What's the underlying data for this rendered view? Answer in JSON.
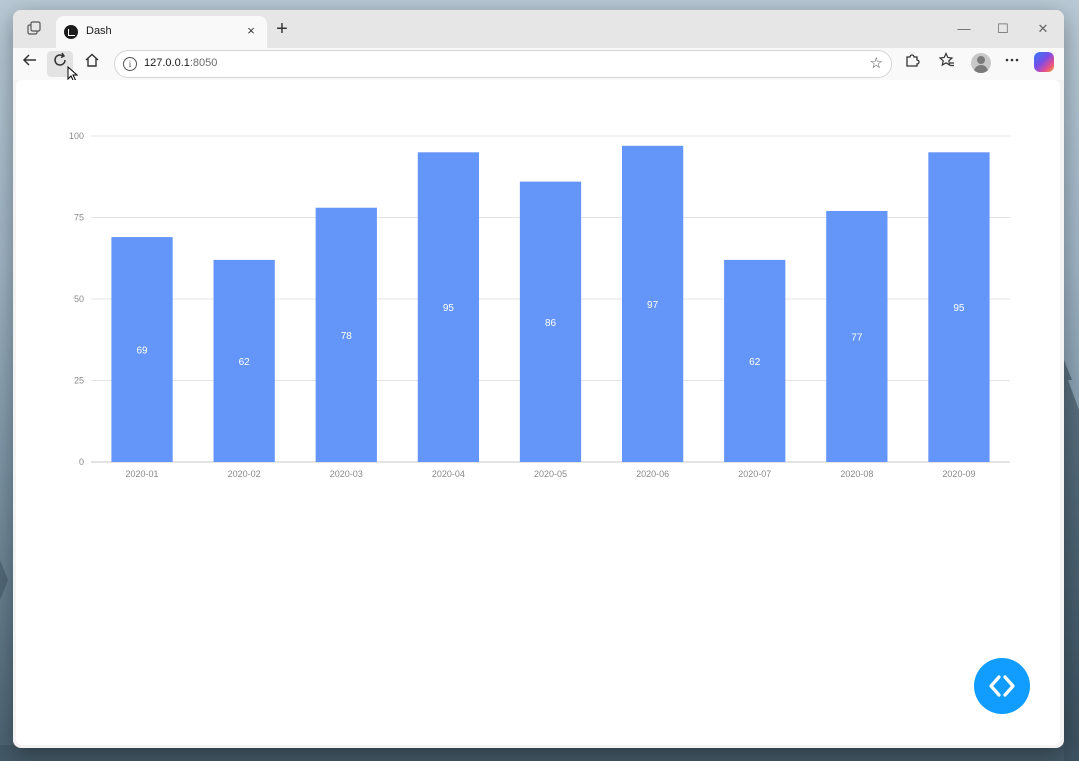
{
  "browser": {
    "tab_title": "Dash",
    "tab_close": "×",
    "new_tab": "+",
    "address_host": "127.0.0.1",
    "address_port": ":8050",
    "window_controls": {
      "minimize": "—",
      "maximize": "☐",
      "close": "✕"
    },
    "icons": {
      "workspaces": "workspaces-icon",
      "back": "back-arrow-icon",
      "refresh": "refresh-icon",
      "home": "home-icon",
      "site_info": "info-icon",
      "favorite": "star-icon",
      "extensions": "extensions-icon",
      "favorites": "favorites-icon",
      "profile": "profile-avatar-icon",
      "more": "more-dots-icon",
      "copilot": "copilot-icon"
    }
  },
  "colors": {
    "bar": "#6495f9",
    "bar_label": "#ffffff",
    "grid": "#e4e4e4",
    "tick_text": "#8a8a8a",
    "fab": "#119dff"
  },
  "fab": {
    "icon": "code-brackets-icon"
  },
  "chart_data": {
    "type": "bar",
    "categories": [
      "2020-01",
      "2020-02",
      "2020-03",
      "2020-04",
      "2020-05",
      "2020-06",
      "2020-07",
      "2020-08",
      "2020-09"
    ],
    "values": [
      69,
      62,
      78,
      95,
      86,
      97,
      62,
      77,
      95
    ],
    "ylim": [
      0,
      100
    ],
    "yticks": [
      0,
      25,
      50,
      75,
      100
    ],
    "grid": true,
    "data_labels": true,
    "title": "",
    "xlabel": "",
    "ylabel": ""
  }
}
